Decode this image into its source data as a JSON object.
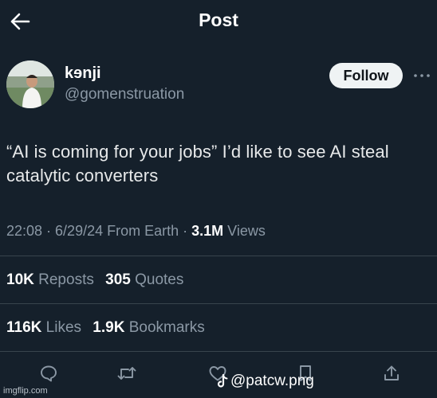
{
  "header": {
    "title": "Post",
    "back_icon": "arrow-left-icon"
  },
  "author": {
    "display_name": "kɘnji",
    "handle": "@gomenstruation",
    "follow_label": "Follow",
    "more_icon": "more-horizontal-icon"
  },
  "tweet": {
    "line1": "“AI is coming for your jobs” I’d like to see AI steal",
    "line2": "catalytic converters"
  },
  "meta": {
    "time": "22:08",
    "sep1": " · ",
    "date": "6/29/24",
    "source": " From Earth",
    "sep2": " · ",
    "views_count": "3.1M",
    "views_label": " Views"
  },
  "stats": {
    "reposts_count": "10K",
    "reposts_label": "Reposts",
    "quotes_count": "305",
    "quotes_label": "Quotes",
    "likes_count": "116K",
    "likes_label": "Likes",
    "bookmarks_count": "1.9K",
    "bookmarks_label": "Bookmarks"
  },
  "actions": [
    "reply-icon",
    "repost-icon",
    "like-icon",
    "bookmark-icon",
    "share-icon"
  ],
  "watermarks": {
    "tiktok": "@patcw.png",
    "tiktok_icon": "tiktok-logo-icon",
    "imgflip": "imgflip.com"
  },
  "colors": {
    "background": "#15202b",
    "text_primary": "#e7e9ea",
    "text_secondary": "#8b98a5",
    "follow_bg": "#eff3f4",
    "divider": "#38444d"
  }
}
